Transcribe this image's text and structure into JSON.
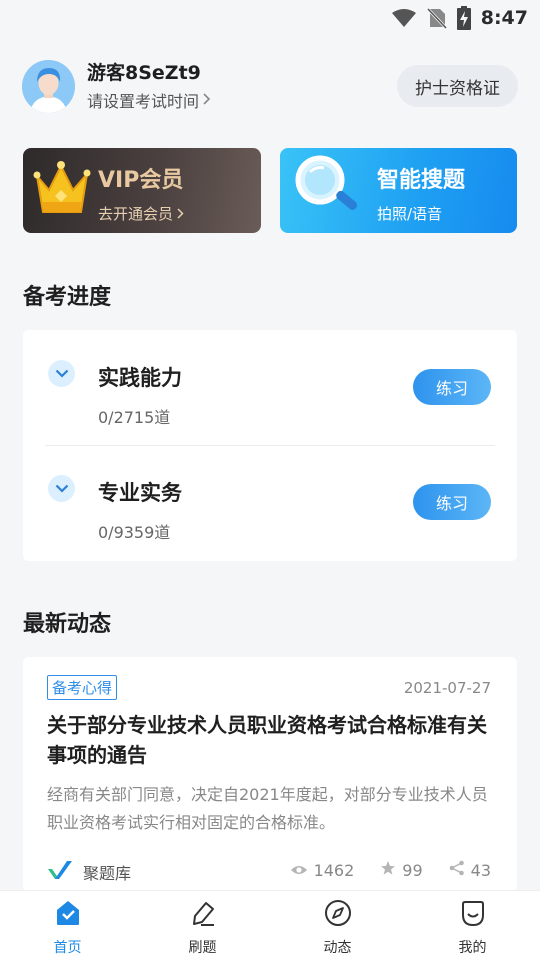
{
  "status_bar": {
    "time": "8:47",
    "icons": [
      "wifi-icon",
      "no-sim-icon",
      "battery-charging-icon"
    ]
  },
  "profile": {
    "username": "游客8SeZt9",
    "subtitle": "请设置考试时间",
    "cert_button": "护士资格证"
  },
  "promo": {
    "vip": {
      "title": "VIP会员",
      "subtitle": "去开通会员"
    },
    "search": {
      "title": "智能搜题",
      "subtitle": "拍照/语音"
    }
  },
  "progress": {
    "title": "备考进度",
    "items": [
      {
        "name": "实践能力",
        "count": "0/2715道",
        "button": "练习"
      },
      {
        "name": "专业实务",
        "count": "0/9359道",
        "button": "练习"
      }
    ]
  },
  "news": {
    "title": "最新动态",
    "item": {
      "tag": "备考心得",
      "date": "2021-07-27",
      "headline": "关于部分专业技术人员职业资格考试合格标准有关事项的通告",
      "summary": "经商有关部门同意，决定自2021年度起，对部分专业技术人员职业资格考试实行相对固定的合格标准。",
      "source": "聚题库",
      "views": "1462",
      "stars": "99",
      "shares": "43"
    }
  },
  "tabbar": {
    "items": [
      {
        "label": "首页",
        "icon": "home-icon",
        "active": true
      },
      {
        "label": "刷题",
        "icon": "pencil-icon",
        "active": false
      },
      {
        "label": "动态",
        "icon": "compass-icon",
        "active": false
      },
      {
        "label": "我的",
        "icon": "profile-icon",
        "active": false
      }
    ]
  },
  "colors": {
    "accent": "#1e88e5",
    "vip_gold": "#e9c9a1",
    "background": "#f5f6f8"
  }
}
